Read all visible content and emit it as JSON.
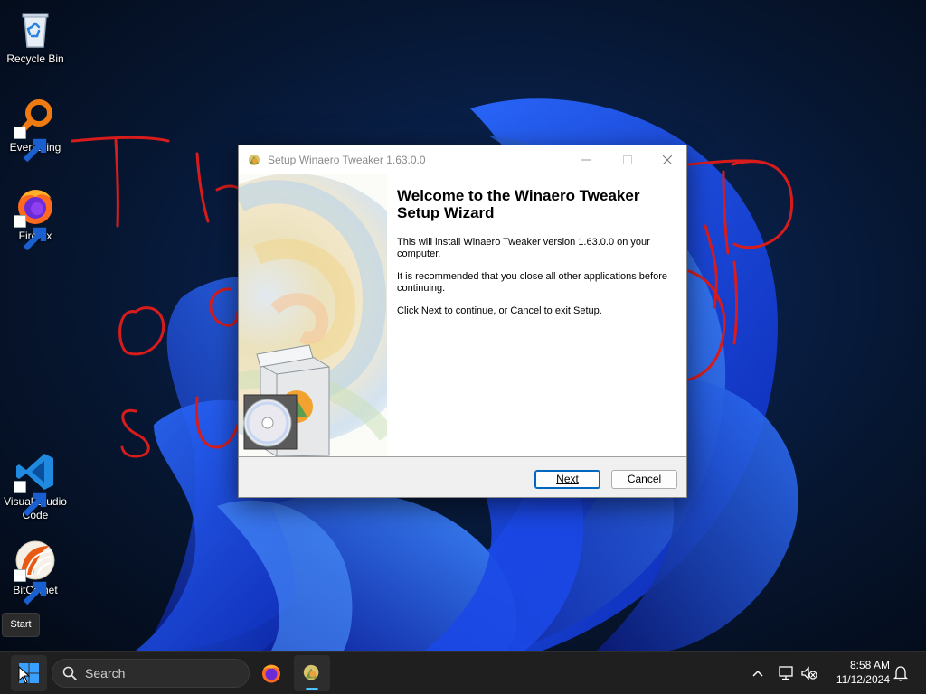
{
  "desktop": {
    "icons": [
      {
        "label": "Recycle Bin",
        "icon": "recycle-bin-icon"
      },
      {
        "label": "Everything",
        "icon": "everything-search-icon"
      },
      {
        "label": "Firefox",
        "icon": "firefox-icon"
      },
      {
        "label": "Visual Studio Code",
        "icon": "vscode-icon"
      },
      {
        "label": "BitComet",
        "icon": "bitcomet-icon"
      }
    ]
  },
  "dialog": {
    "title": "Setup Winaero Tweaker 1.63.0.0",
    "heading": "Welcome to the Winaero Tweaker\nSetup Wizard",
    "paragraphs": [
      "This will install Winaero Tweaker version 1.63.0.0 on your computer.",
      "It is recommended that you close all other applications before continuing.",
      "Click Next to continue, or Cancel to exit Setup."
    ],
    "buttons": {
      "next": "Next",
      "cancel": "Cancel"
    }
  },
  "tooltip": {
    "text": "Start"
  },
  "taskbar": {
    "search_placeholder": "Search",
    "pinned": [
      "firefox-icon",
      "winaero-setup-icon"
    ],
    "clock": {
      "time": "8:58 AM",
      "date": "11/12/2024"
    }
  },
  "colors": {
    "accent": "#0067c0",
    "taskbar": "#1f1f1f",
    "annotation_red": "#d81c1c",
    "wallpaper_blue": "#1f4fe0"
  }
}
